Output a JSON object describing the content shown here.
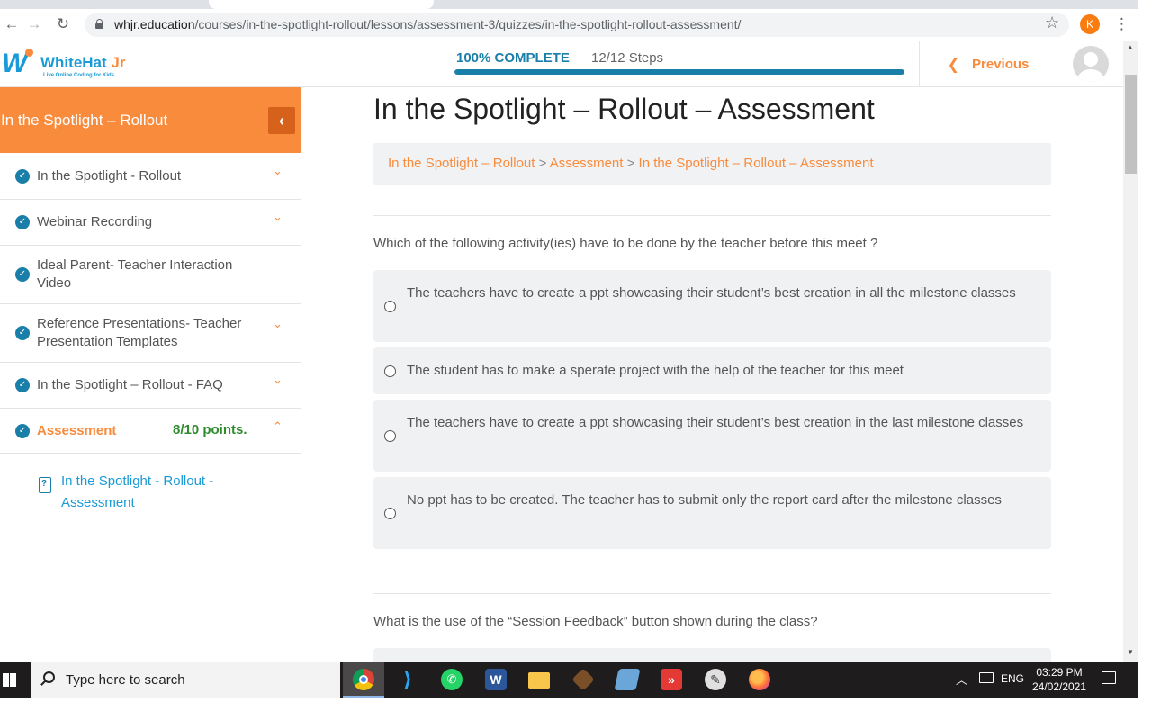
{
  "browser": {
    "url_host": "whjr.education",
    "url_path": "/courses/in-the-spotlight-rollout/lessons/assessment-3/quizzes/in-the-spotlight-rollout-assessment/",
    "profile_initial": "K"
  },
  "header": {
    "logo_brand_main": "WhiteHat",
    "logo_brand_accent": " Jr",
    "logo_tagline": "Live Online Coding for Kids",
    "progress_label": "100% COMPLETE",
    "progress_steps": "12/12 Steps",
    "progress_fraction": 1.0,
    "previous_label": "Previous"
  },
  "sidebar": {
    "title": "In the Spotlight – Rollout",
    "items": [
      {
        "label": "In the Spotlight - Rollout",
        "expandable": true
      },
      {
        "label": "Webinar Recording",
        "expandable": true
      },
      {
        "label": "Ideal Parent- Teacher Interaction Video",
        "expandable": false
      },
      {
        "label": "Reference Presentations- Teacher Presentation Templates",
        "expandable": true
      },
      {
        "label": "In the Spotlight – Rollout - FAQ",
        "expandable": true
      },
      {
        "label": "Assessment",
        "points": "8/10 points.",
        "expanded": true
      }
    ],
    "sub_item": "In the Spotlight - Rollout - Assessment"
  },
  "main": {
    "title": "In the Spotlight – Rollout – Assessment",
    "breadcrumb": [
      "In the Spotlight – Rollout",
      "Assessment",
      "In the Spotlight – Rollout – Assessment"
    ],
    "breadcrumb_sep": " > ",
    "questions": [
      {
        "text": "Which of the following activity(ies) have to be done by the teacher before this meet ?",
        "answers": [
          "The teachers have to create a ppt showcasing their student’s best creation in all the milestone classes",
          "The student has to make a sperate project with the help of the teacher for this meet",
          "The teachers have to create a ppt showcasing their student’s best creation in the last milestone classes",
          "No ppt has to be created. The teacher has to submit only the report card after the milestone classes"
        ]
      },
      {
        "text": "What is the use of the “Session Feedback” button shown during the class?",
        "answers": []
      }
    ]
  },
  "taskbar": {
    "search_placeholder": "Type here to search",
    "apps": [
      "chrome-icon",
      "vscode-icon",
      "whatsapp-icon",
      "word-icon",
      "file-explorer-icon",
      "git-gui-icon",
      "notepad-icon",
      "anydesk-icon",
      "paint-icon",
      "firefox-icon"
    ],
    "lang": "ENG",
    "time": "03:29 PM",
    "date": "24/02/2021"
  },
  "colors": {
    "accent_orange": "#f98b3c",
    "accent_blue": "#1a7fa8",
    "points_green": "#2e8b2e"
  }
}
